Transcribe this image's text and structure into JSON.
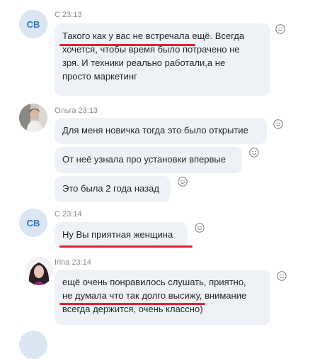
{
  "messages": [
    {
      "avatar_initials": "CB",
      "meta": "С 23:13",
      "lines": [
        "Такого как у вас не встречала ещё. Всегда",
        "хочется, чтобы время было потрачено не",
        "зря. И техники реально работали,а не",
        "просто маркетинг"
      ]
    },
    {
      "meta": "Ольга 23:13",
      "bubbles": [
        "Для меня новичка тогда это было открытие",
        "От неё узнала про установки впервые",
        "Это была 2 года назад"
      ]
    },
    {
      "avatar_initials": "CB",
      "meta": "С 23:14",
      "bubble": "Ну Вы приятная женщина"
    },
    {
      "meta": "Irina 23:14",
      "lines": [
        "ещё очень понравилось слушать, приятно,",
        "не думала что так долго высижу,  внимание",
        "всегда держится,  очень классно)"
      ]
    }
  ],
  "colors": {
    "bubble_bg": "#eef2f6",
    "accent_underline": "#e0232f",
    "initials_avatar_bg": "#dbe6f2",
    "initials_avatar_text": "#2e73c6"
  },
  "icons": {
    "reaction": "smiley-icon"
  }
}
